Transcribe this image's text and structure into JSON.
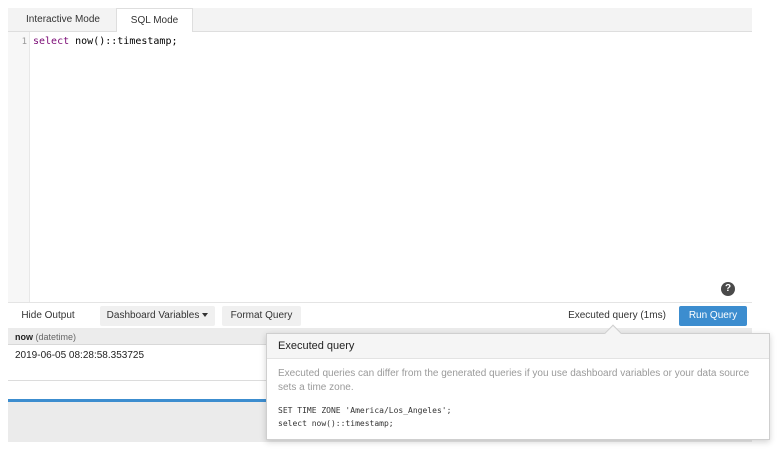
{
  "tabs": {
    "interactive_label": "Interactive Mode",
    "sql_label": "SQL Mode"
  },
  "editor": {
    "line_number": "1",
    "code_keyword": "select",
    "code_rest": " now()::timestamp;"
  },
  "help_icon": {
    "glyph": "?"
  },
  "toolbar": {
    "hide_output_label": "Hide Output",
    "dashboard_variables_label": "Dashboard Variables",
    "format_query_label": "Format Query",
    "executed_status": "Executed query (1ms)",
    "run_query_label": "Run Query"
  },
  "results": {
    "column_name": "now",
    "column_type": "(datetime)",
    "rows": [
      "2019-06-05 08:28:58.353725"
    ]
  },
  "popover": {
    "title": "Executed query",
    "description": "Executed queries can differ from the generated queries if you use dashboard variables or your data source sets a time zone.",
    "code_line_1": "SET TIME ZONE 'America/Los_Angeles';",
    "code_line_2": "select now()::timestamp;"
  },
  "colors": {
    "accent": "#3c8dcf",
    "tab_bar": "#f3f3f3",
    "results_bg": "#ebebeb"
  }
}
